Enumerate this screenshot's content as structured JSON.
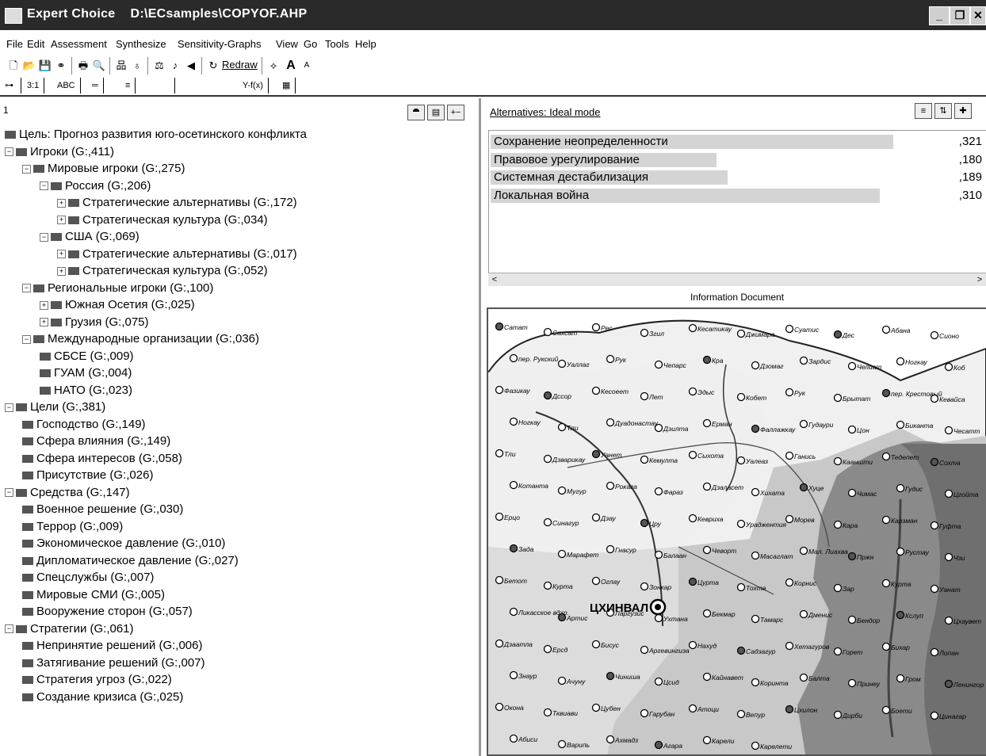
{
  "window": {
    "title": "Expert Choice    D:\\ECsamples\\COPYOF.AHP",
    "minimize": "_",
    "restore": "❐",
    "close": "✕"
  },
  "menu": [
    "File",
    "Edit",
    "Assessment",
    "Synthesize",
    "Sensitivity-Graphs",
    "View",
    "Go",
    "Tools",
    "Help"
  ],
  "toolbar": {
    "redraw_label": "Redraw"
  },
  "tabs": [
    "3:1",
    "ABC",
    "═",
    "≡",
    "",
    "Y-f(x)",
    "▦"
  ],
  "left": {
    "header_num": "1",
    "tree": [
      {
        "label": "Цель: Прогноз развития юго-осетинского конфликта",
        "level": 0,
        "pm": ""
      },
      {
        "label": "Игроки (G:,411)",
        "level": 0,
        "pm": "−"
      },
      {
        "label": "Мировые игроки (G:,275)",
        "level": 1,
        "pm": "−"
      },
      {
        "label": "Россия (G:,206)",
        "level": 2,
        "pm": "−"
      },
      {
        "label": "Стратегические альтернативы (G:,172)",
        "level": 3,
        "pm": "+"
      },
      {
        "label": "Стратегическая культура (G:,034)",
        "level": 3,
        "pm": "+"
      },
      {
        "label": "США (G:,069)",
        "level": 2,
        "pm": "−"
      },
      {
        "label": "Стратегические альтернативы (G:,017)",
        "level": 3,
        "pm": "+"
      },
      {
        "label": "Стратегическая культура (G:,052)",
        "level": 3,
        "pm": "+"
      },
      {
        "label": "Региональные игроки (G:,100)",
        "level": 1,
        "pm": "−"
      },
      {
        "label": "Южная Осетия (G:,025)",
        "level": 2,
        "pm": "+"
      },
      {
        "label": "Грузия (G:,075)",
        "level": 2,
        "pm": "+"
      },
      {
        "label": "Международные организации (G:,036)",
        "level": 1,
        "pm": "−"
      },
      {
        "label": "СБСЕ (G:,009)",
        "level": 2,
        "pm": ""
      },
      {
        "label": "ГУАМ (G:,004)",
        "level": 2,
        "pm": ""
      },
      {
        "label": "НАТО (G:,023)",
        "level": 2,
        "pm": ""
      },
      {
        "label": "Цели (G:,381)",
        "level": 0,
        "pm": "−"
      },
      {
        "label": "Господство (G:,149)",
        "level": 1,
        "pm": ""
      },
      {
        "label": "Сфера влияния (G:,149)",
        "level": 1,
        "pm": ""
      },
      {
        "label": "Сфера интересов (G:,058)",
        "level": 1,
        "pm": ""
      },
      {
        "label": "Присутствие (G:,026)",
        "level": 1,
        "pm": ""
      },
      {
        "label": "Средства (G:,147)",
        "level": 0,
        "pm": "−"
      },
      {
        "label": "Военное решение (G:,030)",
        "level": 1,
        "pm": ""
      },
      {
        "label": "Террор (G:,009)",
        "level": 1,
        "pm": ""
      },
      {
        "label": "Экономическое давление (G:,010)",
        "level": 1,
        "pm": ""
      },
      {
        "label": "Дипломатическое давление (G:,027)",
        "level": 1,
        "pm": ""
      },
      {
        "label": "Спецслужбы (G:,007)",
        "level": 1,
        "pm": ""
      },
      {
        "label": "Мировые СМИ (G:,005)",
        "level": 1,
        "pm": ""
      },
      {
        "label": "Вооружение сторон (G:,057)",
        "level": 1,
        "pm": ""
      },
      {
        "label": "Стратегии (G:,061)",
        "level": 0,
        "pm": "−"
      },
      {
        "label": "Непринятие решений (G:,006)",
        "level": 1,
        "pm": ""
      },
      {
        "label": "Затягивание решений (G:,007)",
        "level": 1,
        "pm": ""
      },
      {
        "label": "Стратегия угроз (G:,022)",
        "level": 1,
        "pm": ""
      },
      {
        "label": "Создание кризиса (G:,025)",
        "level": 1,
        "pm": ""
      }
    ]
  },
  "right": {
    "alternatives_title": "Alternatives: Ideal mode",
    "alternatives": [
      {
        "label": "Сохранение неопределенности",
        "value": ",321",
        "fraction": 0.321
      },
      {
        "label": "Правовое урегулирование",
        "value": ",180",
        "fraction": 0.18
      },
      {
        "label": "Системная дестабилизация",
        "value": ",189",
        "fraction": 0.189
      },
      {
        "label": "Локальная война",
        "value": ",310",
        "fraction": 0.31
      }
    ],
    "info_doc_title": "Information Document",
    "map_city": "ЦХИНВАЛ",
    "map_labels": [
      "Сатат",
      "Сахсат",
      "Рес",
      "Згил",
      "Кесатикау",
      "Джимара",
      "Суатис",
      "Дес",
      "Абана",
      "Сионо",
      "пер. Рукский",
      "Уаллаг",
      "Рук",
      "Чепарс",
      "Кра",
      "Дзомаг",
      "Зардис",
      "Челиат",
      "Ногкау",
      "Коб",
      "Фазикау",
      "Дссор",
      "Кесоеет",
      "Лет",
      "Эдыс",
      "Кобет",
      "Рук",
      "Брытат",
      "пер. Крестовый",
      "Кевайса",
      "Ногкау",
      "Тли",
      "Дуадонастау",
      "Дзилта",
      "Ерман",
      "Фаллажкау",
      "Гудаури",
      "Цон",
      "Биканта",
      "Чесатт",
      "Тли",
      "Дзварикау",
      "Уанет",
      "Кемулта",
      "Сыхота",
      "Уалеаз",
      "Ганись",
      "Кааншти",
      "Тедепет",
      "Сохта",
      "Котанта",
      "Мугур",
      "Рокага",
      "Фараз",
      "Дзаласет",
      "Хихата",
      "Хуце",
      "Чимас",
      "Гудис",
      "Цгойта",
      "Ерцо",
      "Синагур",
      "Дзау",
      "Цру",
      "Кевриха",
      "Ураджентия",
      "Морев",
      "Кара",
      "Карзман",
      "Гуфта",
      "Зада",
      "Марафет",
      "Гнасур",
      "Балаан",
      "Чеворт",
      "Масаглат",
      "Мал. Лиахва",
      "Пржн",
      "Рустау",
      "Чзи",
      "Бетот",
      "Курта",
      "Оглау",
      "Зонкар",
      "Цурта",
      "Тохта",
      "Корнис",
      "Зар",
      "Курта",
      "Уанат",
      "Ликасское вдхр.",
      "Артис",
      "Ларгузис",
      "Ухтана",
      "Бекмар",
      "Тамарс",
      "Дменис",
      "Бендор",
      "Кслуп",
      "Цхаувет",
      "Дзаатла",
      "Ерсд",
      "Бисус",
      "Аргевингиза",
      "Нахуд",
      "Садзагур",
      "Хетагуров",
      "Горет",
      "Бихар",
      "Лопан",
      "Знаур",
      "Ачуну",
      "Чиниша",
      "Цсид",
      "Кайнавет",
      "Коринта",
      "Балта",
      "Принеу",
      "Гром",
      "Ленингор",
      "Окона",
      "Тквиави",
      "Цубен",
      "Гарубан",
      "Атоци",
      "Вепур",
      "Цхилон",
      "Дирби",
      "Боети",
      "Цинагар",
      "Абиси",
      "Варипь",
      "Ахмадз",
      "Агара",
      "Карели",
      "Карелети"
    ]
  }
}
